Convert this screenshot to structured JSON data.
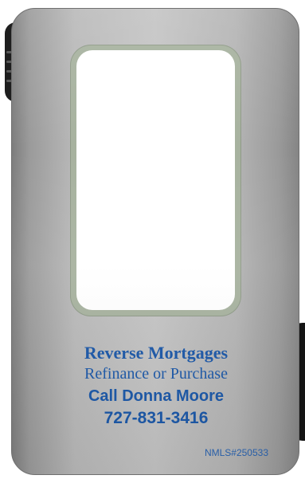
{
  "card": {
    "headline": "Reverse Mortgages",
    "subheadline": "Refinance or Purchase",
    "call_to_action": "Call Donna Moore",
    "phone": "727-831-3416",
    "nmls": "NMLS#250533"
  },
  "colors": {
    "text_blue": "#1a57a8",
    "card_silver": "#bdbdbd",
    "window_frame": "#a7b29f",
    "clip_black": "#1e1e1e"
  }
}
